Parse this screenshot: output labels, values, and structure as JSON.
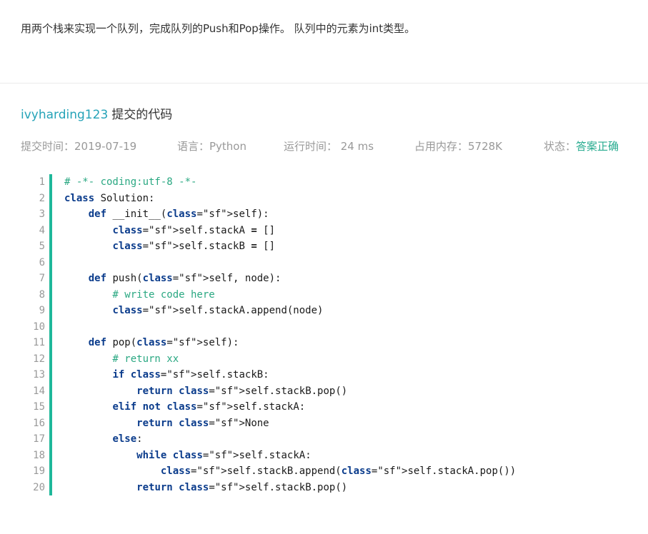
{
  "problem": {
    "description": "用两个栈来实现一个队列，完成队列的Push和Pop操作。 队列中的元素为int类型。"
  },
  "submission": {
    "username": "ivyharding123",
    "title_suffix": "提交的代码",
    "submit_time": "提交时间：2019-07-19",
    "language": "语言：Python",
    "run_time": "运行时间： 24 ms",
    "memory": "占用内存：5728K",
    "status_label": "状态：",
    "status_value": "答案正确"
  },
  "code": {
    "line_numbers": [
      "1",
      "2",
      "3",
      "4",
      "5",
      "6",
      "7",
      "8",
      "9",
      "10",
      "11",
      "12",
      "13",
      "14",
      "15",
      "16",
      "17",
      "18",
      "19",
      "20"
    ],
    "lines": [
      "# -*- coding:utf-8 -*-",
      "class Solution:",
      "    def __init__(self):",
      "        self.stackA = []",
      "        self.stackB = []",
      "",
      "    def push(self, node):",
      "        # write code here",
      "        self.stackA.append(node)",
      "",
      "    def pop(self):",
      "        # return xx",
      "        if self.stackB:",
      "            return self.stackB.pop()",
      "        elif not self.stackA:",
      "            return None",
      "        else:",
      "            while self.stackA:",
      "                self.stackB.append(self.stackA.pop())",
      "            return self.stackB.pop()"
    ]
  },
  "colors": {
    "username": "#25a3b8",
    "status_ok": "#27ab8f",
    "code_bar": "#1fb89a",
    "keyword": "#0b3c8c",
    "comment": "#2aa882"
  }
}
